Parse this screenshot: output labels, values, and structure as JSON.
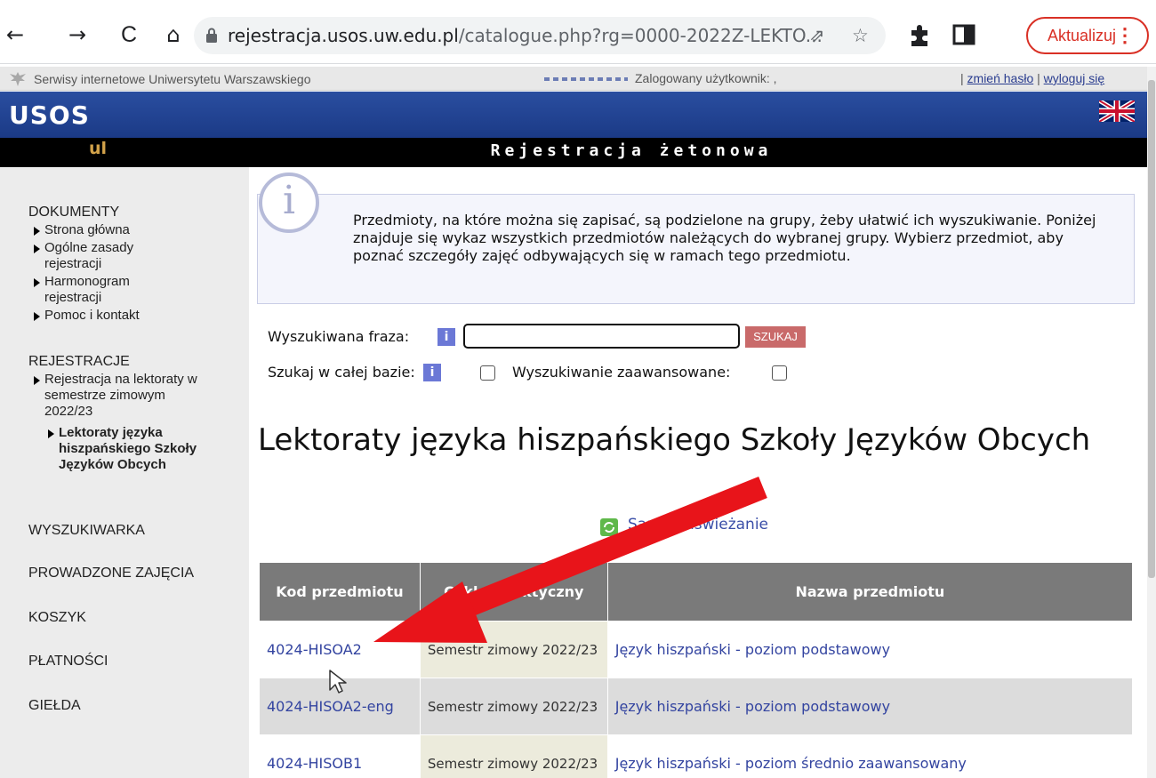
{
  "browser": {
    "url_main": "rejestracja.usos.uw.edu.pl",
    "url_rest": "/catalogue.php?rg=0000-2022Z-LEKTO...",
    "update_label": "Aktualizuj",
    "menu_dots": "⋮",
    "back_icon": "←",
    "forward_icon": "→",
    "reload_icon": "C",
    "home_icon": "⌂",
    "share_icon": "⇗",
    "star_icon": "☆"
  },
  "portal_strip": {
    "site_name": "Serwisy internetowe Uniwersytetu Warszawskiego",
    "user_label": "Zalogowany użytkownik: ,",
    "change_password": "zmień hasło",
    "separator": "|",
    "logout": "wyloguj się"
  },
  "header": {
    "logo": "USOS",
    "logo_sub": "ul",
    "title": "Rejestracja żetonowa"
  },
  "menu": {
    "documents_head": "DOKUMENTY",
    "documents": [
      "Strona główna",
      "Ogólne zasady rejestracji",
      "Harmonogram rejestracji",
      "Pomoc i kontakt"
    ],
    "registrations_head": "REJESTRACJE",
    "registration_item": "Rejestracja na lektoraty w semestrze zimowym 2022/23",
    "registration_subitem": "Lektoraty języka hiszpańskiego Szkoły Języków Obcych",
    "search_engine": "WYSZUKIWARKA",
    "classes": "PROWADZONE ZAJĘCIA",
    "cart": "KOSZYK",
    "payments": "PŁATNOŚCI",
    "exchange": "GIEŁDA"
  },
  "info": {
    "icon": "i",
    "text": "Przedmioty, na które można się zapisać, są podzielone na grupy, żeby ułatwić ich wyszukiwanie. Poniżej znajduje się wykaz wszystkich przedmiotów należących do wybranej grupy. Wybierz przedmiot, aby poznać szczegóły zajęć odbywających się w ramach tego przedmiotu."
  },
  "search": {
    "phrase_label": "Wyszukiwana fraza:",
    "phrase_value": "",
    "button": "SZUKAJ",
    "whole_db_label": "Szukaj w całej bazie:",
    "advanced_label": "Wyszukiwanie zaawansowane:",
    "info_icon": "i"
  },
  "page_title": "Lektoraty języka hiszpańskiego Szkoły Języków Obcych",
  "refresh_label": "Samo odświeżanie",
  "table": {
    "headers": [
      "Kod przedmiotu",
      "Cykl dydaktyczny",
      "Nazwa przedmiotu"
    ],
    "rows": [
      {
        "code": "4024-HISOA2",
        "cycle": "Semestr zimowy 2022/23",
        "name": "Język hiszpański - poziom podstawowy"
      },
      {
        "code": "4024-HISOA2-eng",
        "cycle": "Semestr zimowy 2022/23",
        "name": "Język hiszpański - poziom podstawowy"
      },
      {
        "code": "4024-HISOB1",
        "cycle": "Semestr zimowy 2022/23",
        "name": "Język hiszpański - poziom średnio zaawansowany"
      }
    ]
  },
  "colors": {
    "usos_blue": "#1f3f8f",
    "link": "#3344a0",
    "arrow": "#e8141a",
    "update_red": "#d93025"
  }
}
